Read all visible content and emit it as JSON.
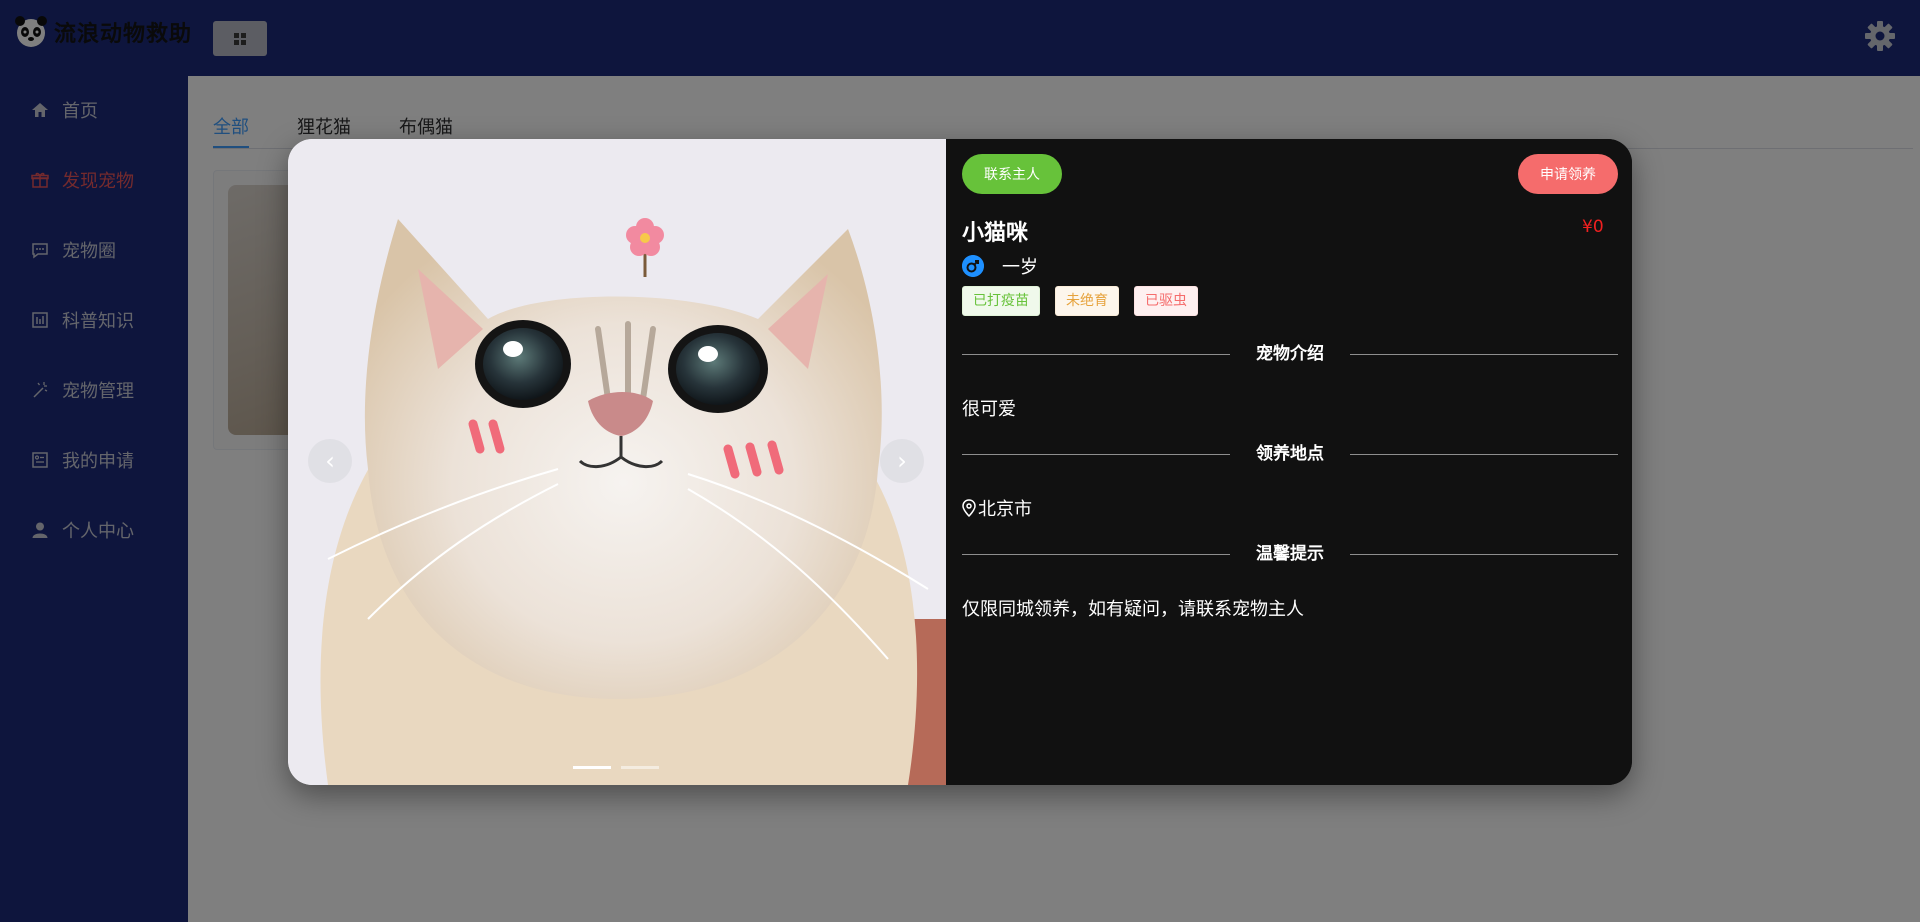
{
  "app": {
    "title": "流浪动物救助"
  },
  "sidebar": {
    "items": [
      {
        "label": "首页",
        "icon": "home-icon",
        "active": false
      },
      {
        "label": "发现宠物",
        "icon": "gift-icon",
        "active": true
      },
      {
        "label": "宠物圈",
        "icon": "chat-icon",
        "active": false
      },
      {
        "label": "科普知识",
        "icon": "chart-icon",
        "active": false
      },
      {
        "label": "宠物管理",
        "icon": "magic-icon",
        "active": false
      },
      {
        "label": "我的申请",
        "icon": "document-icon",
        "active": false
      },
      {
        "label": "个人中心",
        "icon": "user-icon",
        "active": false
      }
    ]
  },
  "main": {
    "tabs": [
      {
        "label": "全部",
        "active": true
      },
      {
        "label": "狸花猫",
        "active": false
      },
      {
        "label": "布偶猫",
        "active": false
      }
    ]
  },
  "modal": {
    "contact_label": "联系主人",
    "apply_label": "申请领养",
    "pet_name": "小猫咪",
    "price": "¥0",
    "age": "一岁",
    "tags": [
      "已打疫苗",
      "未绝育",
      "已驱虫"
    ],
    "sections": {
      "intro_title": "宠物介绍",
      "intro_text": "很可爱",
      "location_title": "领养地点",
      "location_text": "北京市",
      "tips_title": "温馨提示",
      "tips_text": "仅限同城领养，如有疑问，请联系宠物主人"
    },
    "carousel": {
      "slide_count": 2,
      "current": 1
    }
  },
  "colors": {
    "nav_bg": "#1d2a7a",
    "active_nav": "#e8555b",
    "tab_active": "#409eff",
    "contact_btn": "#67c23a",
    "apply_btn": "#f56c6c",
    "price": "#f02020"
  }
}
